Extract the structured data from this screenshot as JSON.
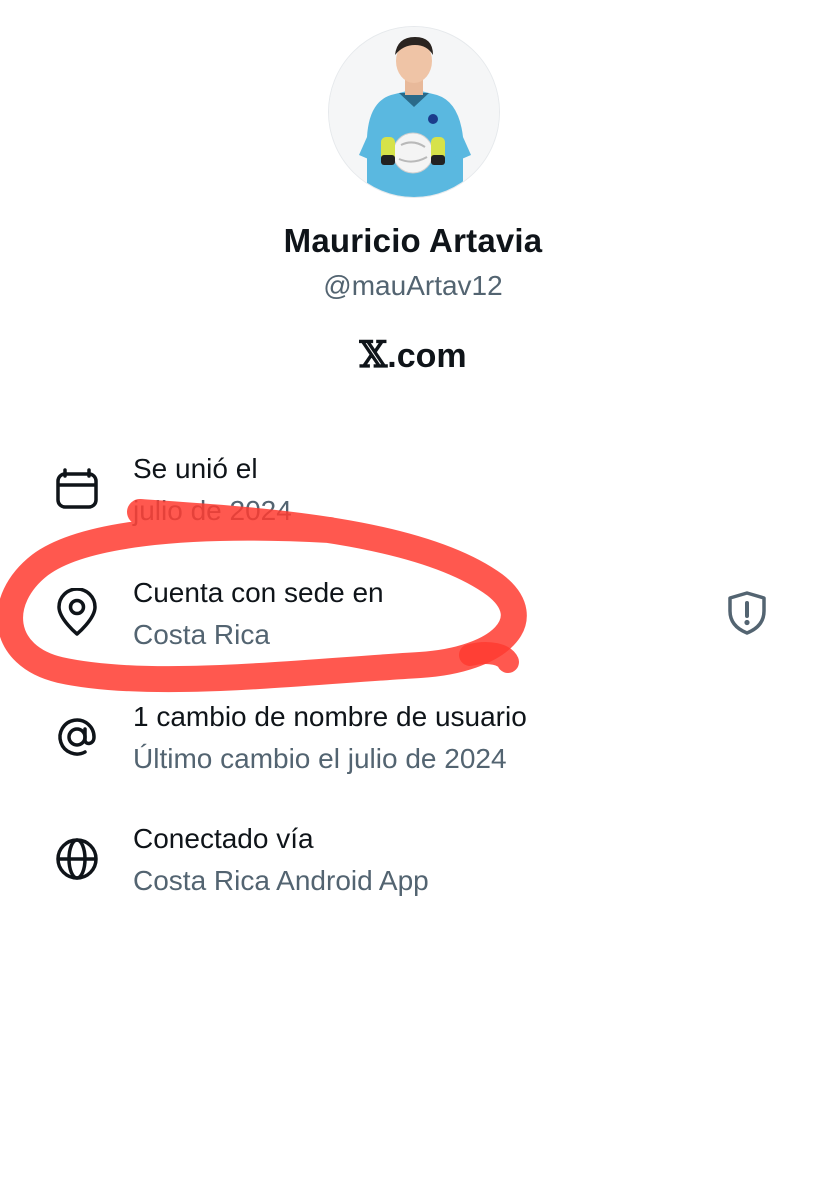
{
  "profile": {
    "display_name": "Mauricio Artavia",
    "handle": "@mauArtav12",
    "brand_letter": "𝕏",
    "brand_suffix": ".com"
  },
  "rows": [
    {
      "icon": "calendar-icon",
      "title": "Se unió el",
      "subtitle": "julio de 2024"
    },
    {
      "icon": "location-pin-icon",
      "title": "Cuenta con sede en",
      "subtitle": "Costa Rica"
    },
    {
      "icon": "at-sign-icon",
      "title": "1 cambio de nombre de usuario",
      "subtitle": "Último cambio el julio de 2024"
    },
    {
      "icon": "globe-icon",
      "title": "Conectado vía",
      "subtitle": "Costa Rica Android App"
    }
  ],
  "colors": {
    "primary_text": "#0f1419",
    "secondary_text": "#536471",
    "annotation": "#ff3b30"
  }
}
